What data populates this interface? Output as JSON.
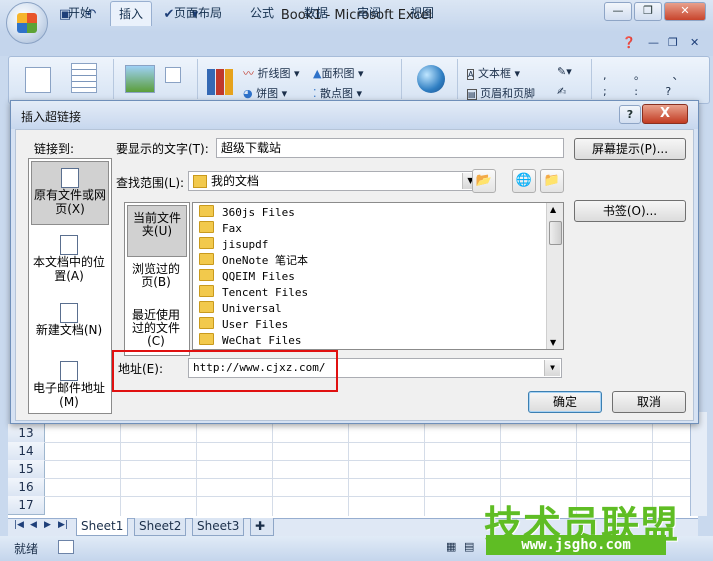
{
  "excel": {
    "window_title": "Book1 - Microsoft Excel",
    "ribbon_tabs": [
      "开始",
      "插入",
      "页面布局",
      "公式",
      "数据",
      "审阅",
      "视图"
    ],
    "active_tab": "插入",
    "ribbon_controls": {
      "line_chart": "折线图",
      "area_chart": "面积图",
      "pie_chart": "饼图",
      "scatter_chart": "散点图",
      "textbox": "文本框",
      "header_footer": "页眉和页脚"
    },
    "row_numbers": [
      "13",
      "14",
      "15",
      "16",
      "17"
    ],
    "sheet_tabs": [
      "Sheet1",
      "Sheet2",
      "Sheet3"
    ],
    "status": "就绪",
    "watermark_text": "技术员联盟",
    "watermark_url": "www.jsgho.com"
  },
  "dialog": {
    "title": "插入超链接",
    "help_glyph": "?",
    "close_glyph": "X",
    "link_to_label": "链接到:",
    "link_options": [
      {
        "label": "原有文件或网页(X)",
        "selected": true
      },
      {
        "label": "本文档中的位置(A)",
        "selected": false
      },
      {
        "label": "新建文档(N)",
        "selected": false
      },
      {
        "label": "电子邮件地址(M)",
        "selected": false
      }
    ],
    "display_text_label": "要显示的文字(T):",
    "display_text_value": "超级下载站",
    "screen_tip_button": "屏幕提示(P)...",
    "look_in_label": "查找范围(L):",
    "look_in_value": "我的文档",
    "bookmark_button": "书签(O)...",
    "look_options": [
      {
        "label": "当前文件夹(U)",
        "selected": true
      },
      {
        "label": "浏览过的页(B)",
        "selected": false
      },
      {
        "label": "最近使用过的文件(C)",
        "selected": false
      }
    ],
    "files": [
      "360js Files",
      "Fax",
      "jisupdf",
      "OneNote 笔记本",
      "QQEIM Files",
      "Tencent Files",
      "Universal",
      "User Files",
      "WeChat Files"
    ],
    "address_label": "地址(E):",
    "address_value": "http://www.cjxz.com/",
    "ok_button": "确定",
    "cancel_button": "取消"
  }
}
